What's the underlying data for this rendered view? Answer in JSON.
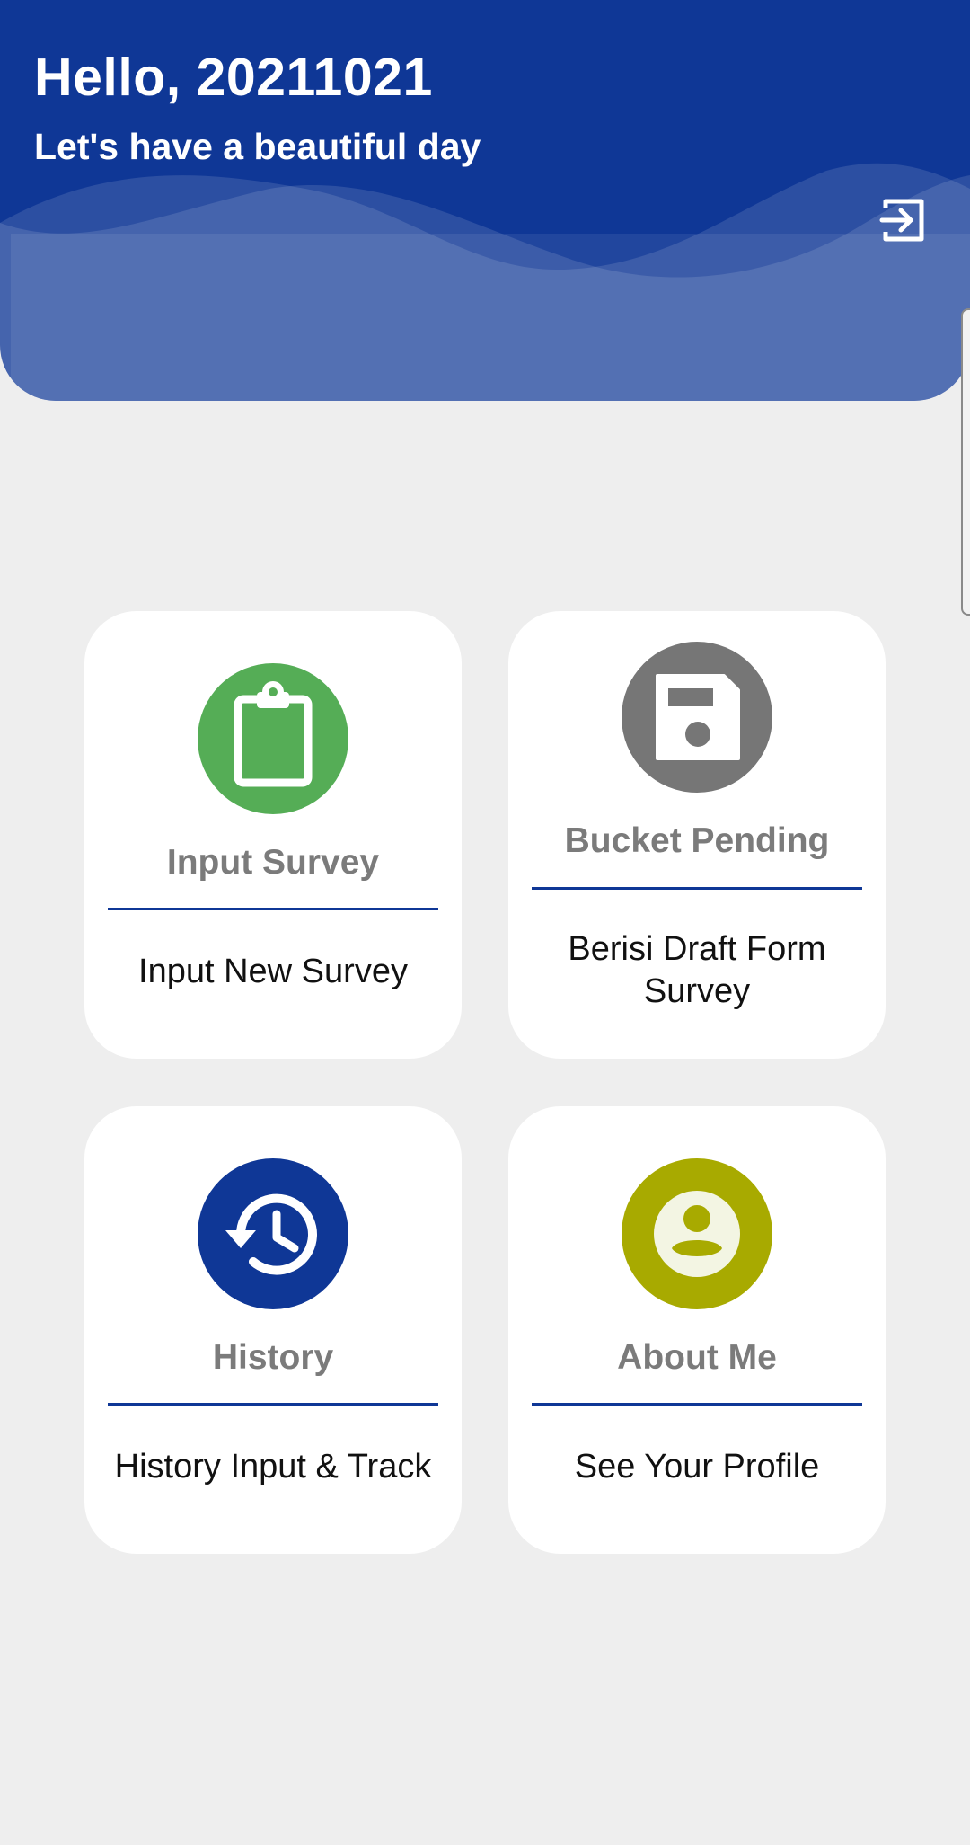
{
  "header": {
    "greeting": "Hello, 20211021",
    "tagline": "Let's have a beautiful day",
    "logout_icon": "logout-icon",
    "color": "#0f3796"
  },
  "menu": [
    {
      "title": "Input Survey",
      "description": "Input New Survey",
      "icon": "clipboard-icon",
      "icon_color": "#55ad56"
    },
    {
      "title": "Bucket Pending",
      "description": "Berisi Draft Form Survey",
      "icon": "floppy-disk-icon",
      "icon_color": "#767676"
    },
    {
      "title": "History",
      "description": "History Input & Track",
      "icon": "history-clock-icon",
      "icon_color": "#0f3796"
    },
    {
      "title": "About Me",
      "description": "See Your Profile",
      "icon": "account-circle-icon",
      "icon_color": "#a8aa00"
    }
  ]
}
